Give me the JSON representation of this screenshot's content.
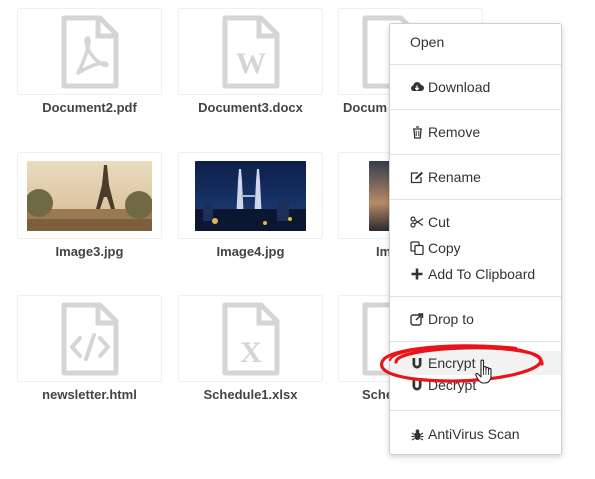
{
  "files": [
    {
      "name": "Document2.pdf",
      "kind": "pdf-file-icon"
    },
    {
      "name": "Document3.docx",
      "kind": "word-file-icon"
    },
    {
      "name": "Docum",
      "kind": "file-icon"
    },
    {
      "name": "Image3.jpg",
      "kind": "image"
    },
    {
      "name": "Image4.jpg",
      "kind": "image"
    },
    {
      "name": "Im",
      "kind": "image"
    },
    {
      "name": "newsletter.html",
      "kind": "code-file-icon"
    },
    {
      "name": "Schedule1.xlsx",
      "kind": "excel-file-icon"
    },
    {
      "name": "Sche",
      "kind": "file-icon"
    }
  ],
  "menu": {
    "open": "Open",
    "download": "Download",
    "remove": "Remove",
    "rename": "Rename",
    "cut": "Cut",
    "copy": "Copy",
    "add_to_clipboard": "Add To Clipboard",
    "drop_to": "Drop to",
    "encrypt": "Encrypt",
    "decrypt": "Decrypt",
    "antivirus": "AntiVirus Scan"
  },
  "colors": {
    "file_icon": "#d5d5d5",
    "highlight_ring": "#e8141a",
    "menu_hover": "#f2f2f2"
  }
}
